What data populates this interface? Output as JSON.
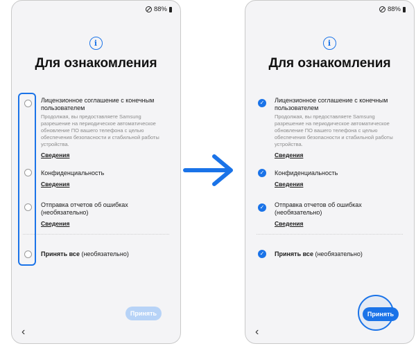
{
  "status": {
    "battery": "88%"
  },
  "screen": {
    "title": "Для ознакомления",
    "items": [
      {
        "title": "Лицензионное соглашение с конечным пользователем",
        "desc": "Продолжая, вы предоставляете Samsung разрешение на периодическое автоматическое обновление ПО вашего телефона с целью обеспечения безопасности и стабильной работы устройства.",
        "link": "Сведения"
      },
      {
        "title": "Конфиденциальность",
        "link": "Сведения"
      },
      {
        "title": "Отправка отчетов об ошибках (необязательно)",
        "link": "Сведения"
      }
    ],
    "accept_all_bold": "Принять все",
    "accept_all_rest": " (необязательно)",
    "accept_button": "Принять"
  },
  "left_state": {
    "checked": [
      false,
      false,
      false,
      false
    ],
    "accept_enabled": false
  },
  "right_state": {
    "checked": [
      true,
      true,
      true,
      true
    ],
    "accept_enabled": true
  },
  "colors": {
    "accent": "#1a73e8",
    "accent_disabled": "#b7d3f7",
    "background": "#f4f4f6"
  },
  "icons": {
    "info": "info-icon",
    "arrow": "arrow-right-icon",
    "check": "check-icon",
    "back": "chevron-left-icon"
  }
}
